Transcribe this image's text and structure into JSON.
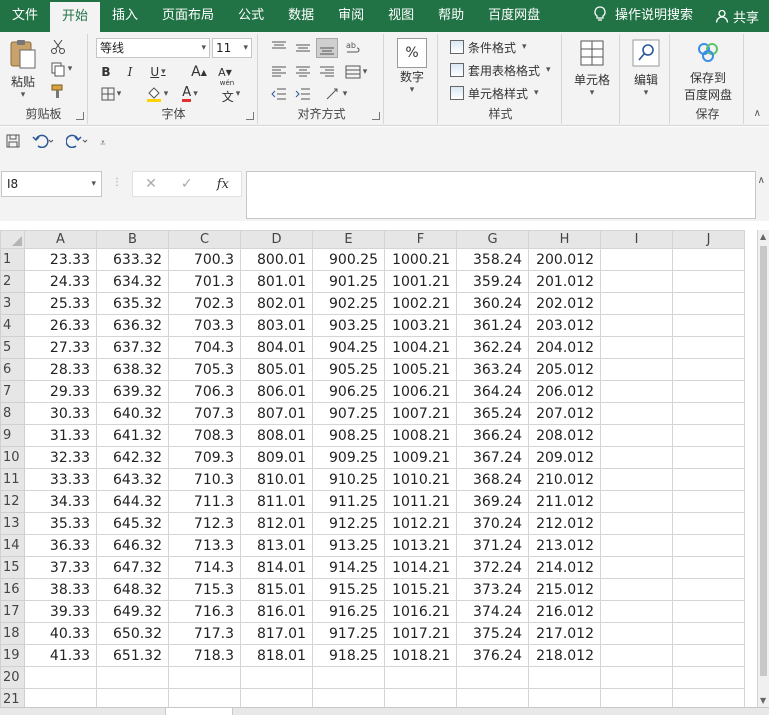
{
  "menu": {
    "tabs": [
      "文件",
      "开始",
      "插入",
      "页面布局",
      "公式",
      "数据",
      "审阅",
      "视图",
      "帮助",
      "百度网盘"
    ],
    "active": "开始",
    "tell_me": "操作说明搜索",
    "share": "共享"
  },
  "ribbon": {
    "clipboard": {
      "paste": "粘贴",
      "label": "剪贴板"
    },
    "font": {
      "name": "等线",
      "size": "11",
      "bold": "B",
      "italic": "I",
      "underline": "U",
      "grow": "A",
      "shrink": "A",
      "phonetic_top": "wén",
      "phonetic": "文",
      "color_letter": "A",
      "label": "字体"
    },
    "alignment": {
      "label": "对齐方式"
    },
    "number": {
      "button": "数字",
      "percent": "%"
    },
    "styles": {
      "conditional": "条件格式",
      "table": "套用表格格式",
      "cell": "单元格样式",
      "label": "样式"
    },
    "cells": {
      "button": "单元格"
    },
    "editing": {
      "button": "编辑"
    },
    "save": {
      "line1": "保存到",
      "line2": "百度网盘",
      "label": "保存"
    }
  },
  "formula_bar": {
    "name_box": "I8",
    "fx": "fx",
    "content": ""
  },
  "grid": {
    "columns": [
      "A",
      "B",
      "C",
      "D",
      "E",
      "F",
      "G",
      "H",
      "I",
      "J"
    ],
    "rows": [
      [
        "23.33",
        "633.32",
        "700.3",
        "800.01",
        "900.25",
        "1000.21",
        "358.24",
        "200.012"
      ],
      [
        "24.33",
        "634.32",
        "701.3",
        "801.01",
        "901.25",
        "1001.21",
        "359.24",
        "201.012"
      ],
      [
        "25.33",
        "635.32",
        "702.3",
        "802.01",
        "902.25",
        "1002.21",
        "360.24",
        "202.012"
      ],
      [
        "26.33",
        "636.32",
        "703.3",
        "803.01",
        "903.25",
        "1003.21",
        "361.24",
        "203.012"
      ],
      [
        "27.33",
        "637.32",
        "704.3",
        "804.01",
        "904.25",
        "1004.21",
        "362.24",
        "204.012"
      ],
      [
        "28.33",
        "638.32",
        "705.3",
        "805.01",
        "905.25",
        "1005.21",
        "363.24",
        "205.012"
      ],
      [
        "29.33",
        "639.32",
        "706.3",
        "806.01",
        "906.25",
        "1006.21",
        "364.24",
        "206.012"
      ],
      [
        "30.33",
        "640.32",
        "707.3",
        "807.01",
        "907.25",
        "1007.21",
        "365.24",
        "207.012"
      ],
      [
        "31.33",
        "641.32",
        "708.3",
        "808.01",
        "908.25",
        "1008.21",
        "366.24",
        "208.012"
      ],
      [
        "32.33",
        "642.32",
        "709.3",
        "809.01",
        "909.25",
        "1009.21",
        "367.24",
        "209.012"
      ],
      [
        "33.33",
        "643.32",
        "710.3",
        "810.01",
        "910.25",
        "1010.21",
        "368.24",
        "210.012"
      ],
      [
        "34.33",
        "644.32",
        "711.3",
        "811.01",
        "911.25",
        "1011.21",
        "369.24",
        "211.012"
      ],
      [
        "35.33",
        "645.32",
        "712.3",
        "812.01",
        "912.25",
        "1012.21",
        "370.24",
        "212.012"
      ],
      [
        "36.33",
        "646.32",
        "713.3",
        "813.01",
        "913.25",
        "1013.21",
        "371.24",
        "213.012"
      ],
      [
        "37.33",
        "647.32",
        "714.3",
        "814.01",
        "914.25",
        "1014.21",
        "372.24",
        "214.012"
      ],
      [
        "38.33",
        "648.32",
        "715.3",
        "815.01",
        "915.25",
        "1015.21",
        "373.24",
        "215.012"
      ],
      [
        "39.33",
        "649.32",
        "716.3",
        "816.01",
        "916.25",
        "1016.21",
        "374.24",
        "216.012"
      ],
      [
        "40.33",
        "650.32",
        "717.3",
        "817.01",
        "917.25",
        "1017.21",
        "375.24",
        "217.012"
      ],
      [
        "41.33",
        "651.32",
        "718.3",
        "818.01",
        "918.25",
        "1018.21",
        "376.24",
        "218.012"
      ],
      [],
      []
    ]
  }
}
